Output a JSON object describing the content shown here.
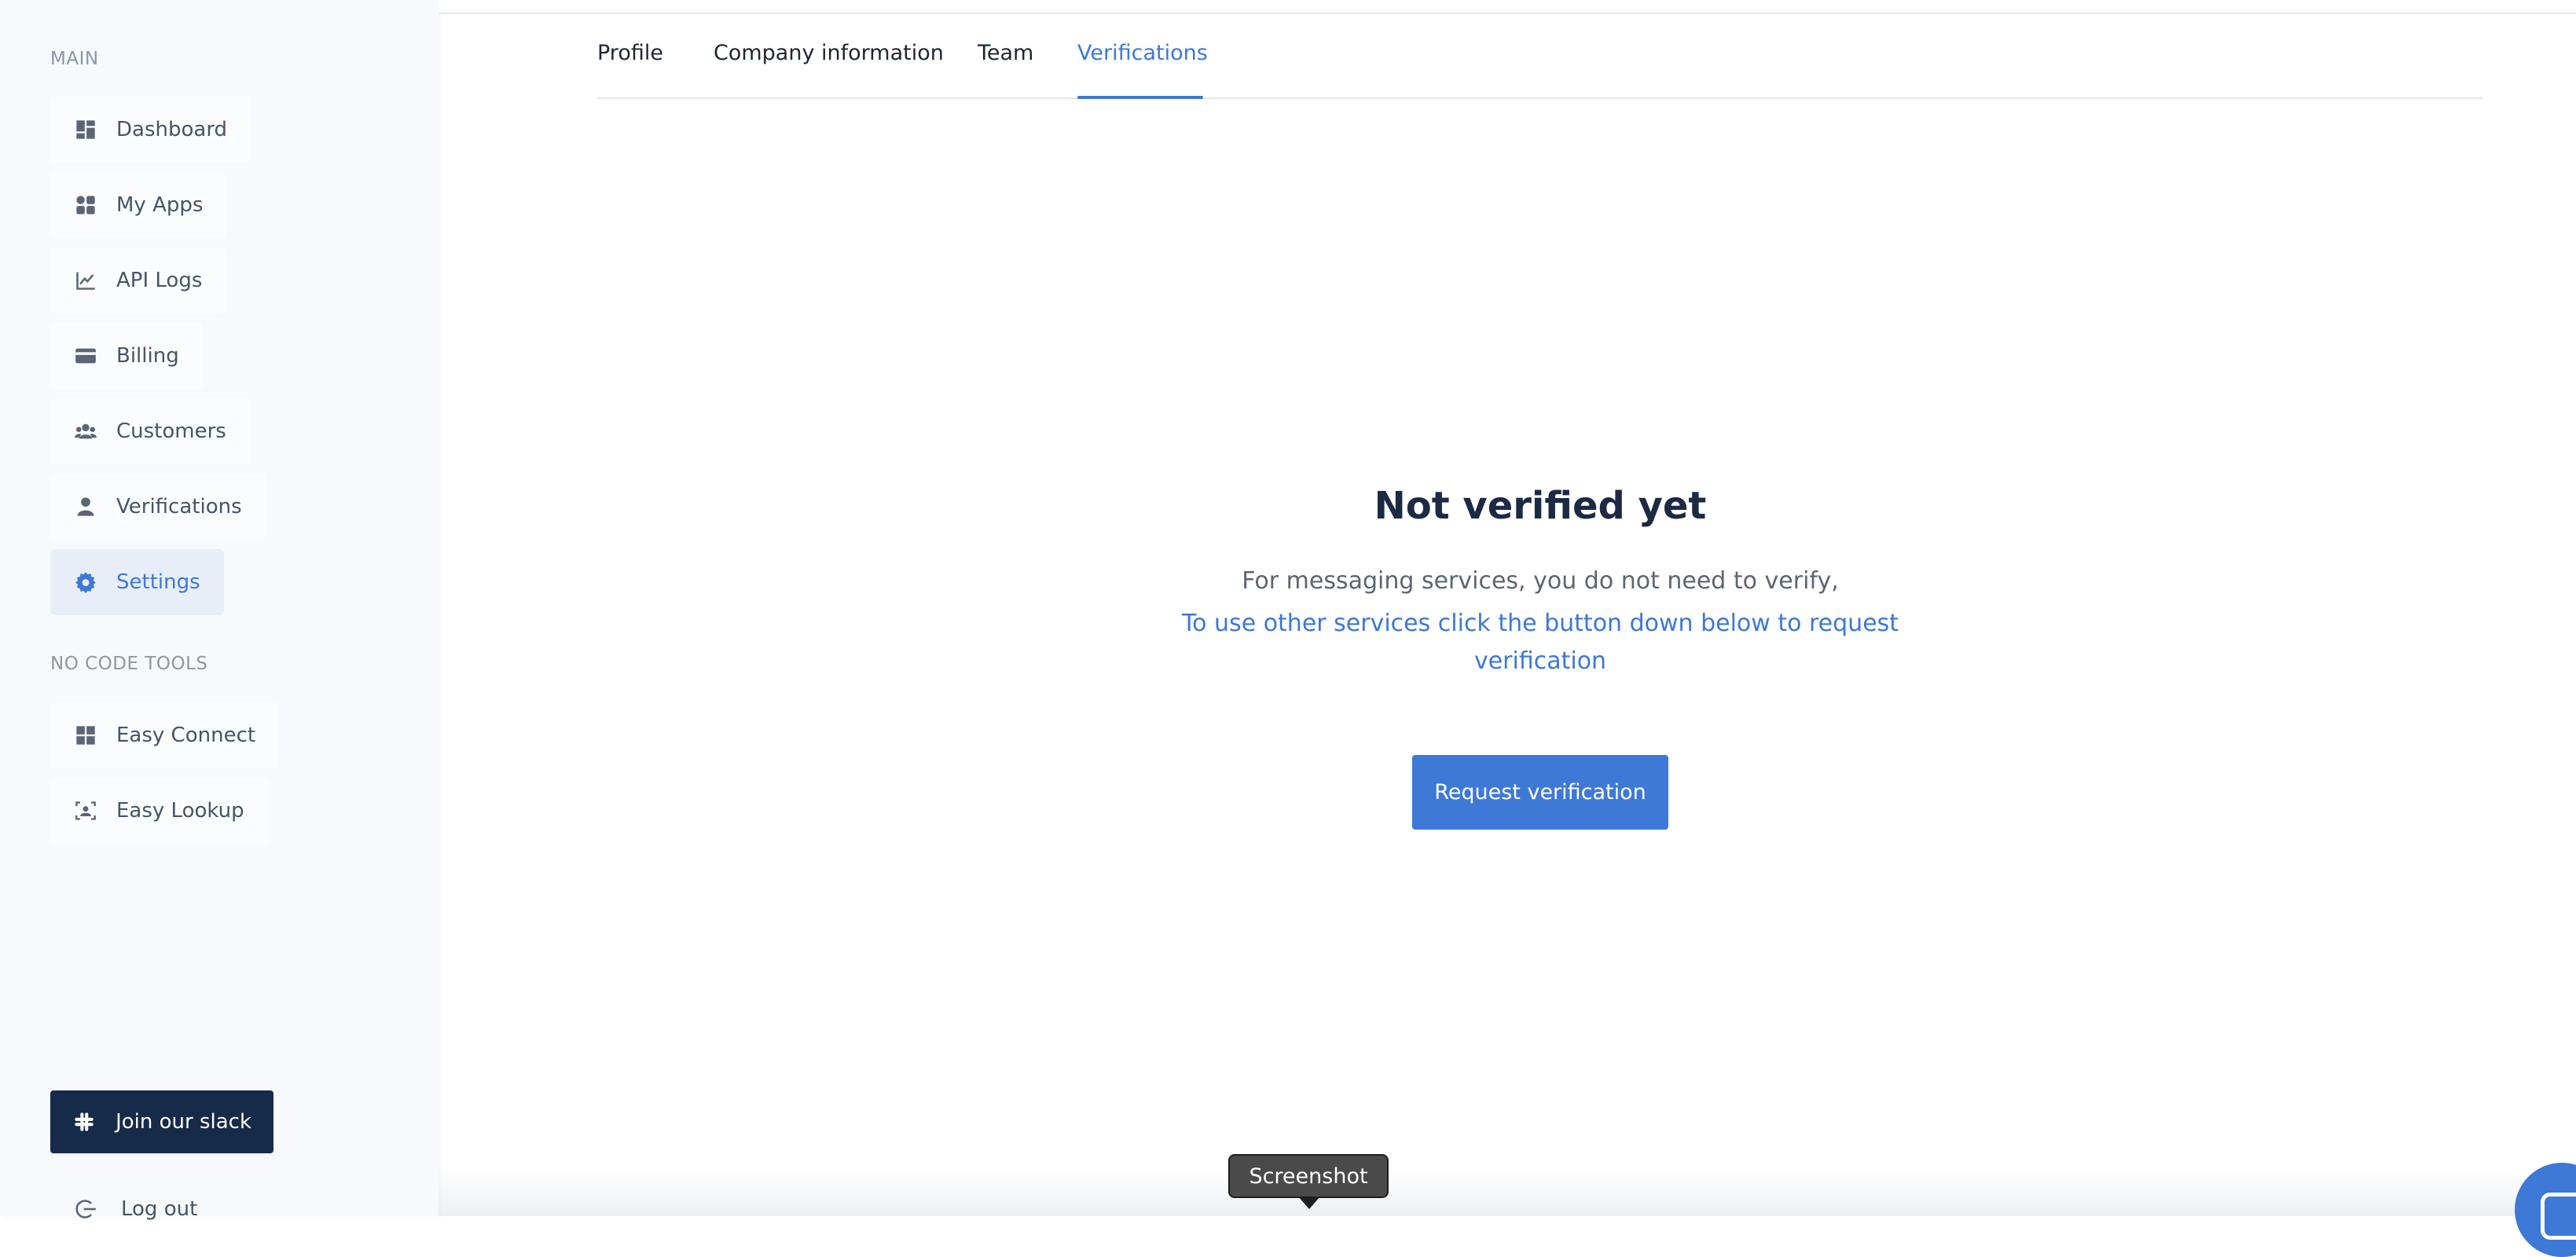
{
  "sidebar": {
    "main_label": "MAIN",
    "items": [
      {
        "label": "Dashboard",
        "icon": "dashboard-icon"
      },
      {
        "label": "My Apps",
        "icon": "apps-icon"
      },
      {
        "label": "API Logs",
        "icon": "chart-line-icon"
      },
      {
        "label": "Billing",
        "icon": "credit-card-icon"
      },
      {
        "label": "Customers",
        "icon": "users-icon"
      },
      {
        "label": "Verifications",
        "icon": "user-icon"
      },
      {
        "label": "Settings",
        "icon": "gear-icon",
        "active": true
      }
    ],
    "tools_label": "NO CODE TOOLS",
    "tools": [
      {
        "label": "Easy Connect",
        "icon": "grid-icon"
      },
      {
        "label": "Easy Lookup",
        "icon": "lookup-icon"
      }
    ],
    "slack_label": "Join our slack",
    "logout_label": "Log out"
  },
  "tabs": [
    {
      "label": "Profile"
    },
    {
      "label": "Company information"
    },
    {
      "label": "Team"
    },
    {
      "label": "Verifications",
      "active": true
    }
  ],
  "empty_state": {
    "title": "Not verified yet",
    "line1": "For messaging services, you do not need to verify,",
    "line2": "To use other services click the button down below to request verification",
    "button_label": "Request verification"
  },
  "tooltip": {
    "label": "Screenshot"
  },
  "colors": {
    "accent": "#3e79d8",
    "sidebar_bg": "#f7f9fd",
    "slack_button_bg": "#162a4a",
    "title": "#1c2a44"
  }
}
